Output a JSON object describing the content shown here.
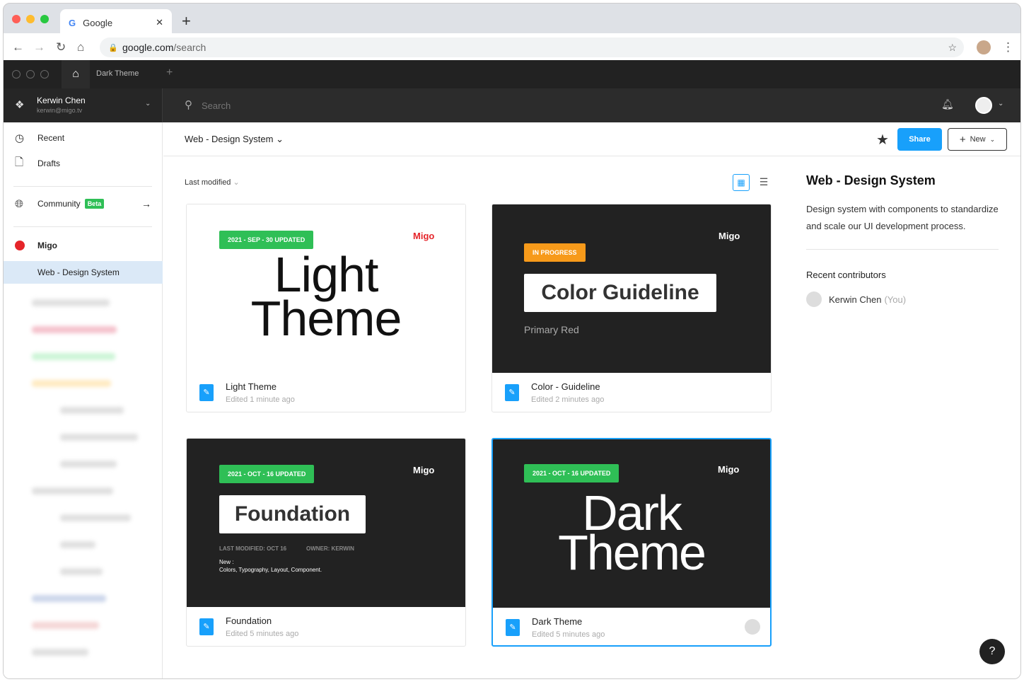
{
  "browser": {
    "tab_title": "Google",
    "url_host": "google.com",
    "url_path": "/search"
  },
  "app": {
    "tab_title": "Dark Theme"
  },
  "user": {
    "name": "Kerwin Chen",
    "email": "kerwin@migo.tv"
  },
  "search": {
    "placeholder": "Search"
  },
  "sidebar": {
    "recent": "Recent",
    "drafts": "Drafts",
    "community": "Community",
    "beta": "Beta",
    "team": "Migo",
    "project": "Web - Design System"
  },
  "toolbar": {
    "title": "Web - Design System",
    "share": "Share",
    "new": "New",
    "sort": "Last modified"
  },
  "files": [
    {
      "name": "Light Theme",
      "edited": "Edited 1 minute ago",
      "badge": "2021 - SEP - 30  UPDATED",
      "line1": "Light",
      "line2": "Theme",
      "logo": "Migo"
    },
    {
      "name": "Color - Guideline",
      "edited": "Edited 2 minutes ago",
      "badge": "IN PROGRESS",
      "title": "Color Guideline",
      "sub": "Primary Red",
      "logo": "Migo"
    },
    {
      "name": "Foundation",
      "edited": "Edited 5 minutes ago",
      "badge": "2021 - OCT - 16  UPDATED",
      "title": "Foundation",
      "meta1": "LAST MODIFIED: OCT 16",
      "meta2": "OWNER: KERWIN",
      "new_label": "New :",
      "new_items": "Colors, Typography, Layout, Component.",
      "logo": "Migo"
    },
    {
      "name": "Dark Theme",
      "edited": "Edited 5 minutes ago",
      "badge": "2021 - OCT - 16  UPDATED",
      "line1": "Dark",
      "line2": "Theme",
      "logo": "Migo"
    }
  ],
  "panel": {
    "title": "Web - Design System",
    "description": "Design system with components to standardize and scale our UI development process.",
    "contributors_label": "Recent contributors",
    "contributor": "Kerwin Chen",
    "you": "(You)"
  },
  "help": "?"
}
